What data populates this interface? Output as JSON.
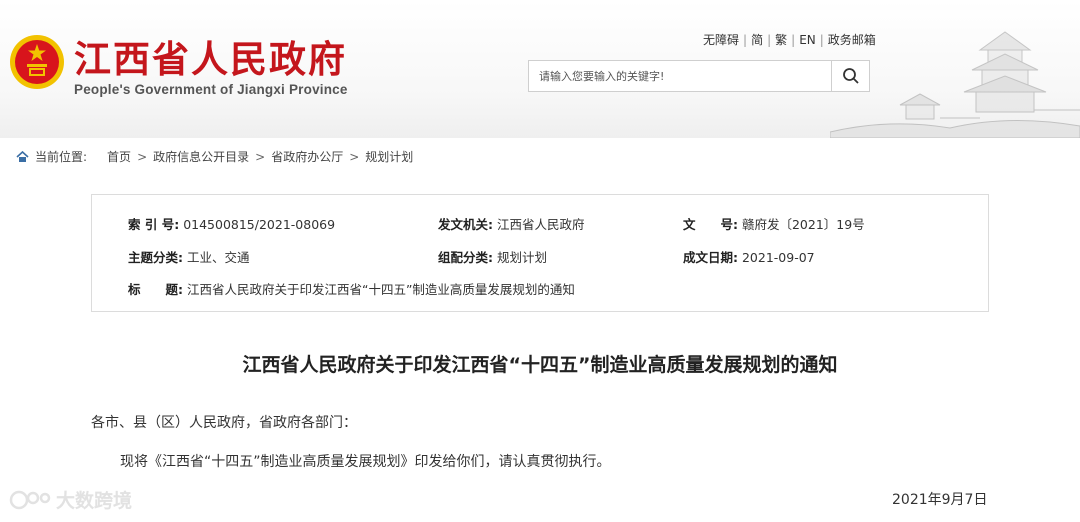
{
  "header": {
    "title": "江西省人民政府",
    "subtitle": "People's Government of Jiangxi Province",
    "links": [
      "无障碍",
      "简",
      "繁",
      "EN",
      "政务邮箱"
    ],
    "search_placeholder": "请输入您要输入的关键字!"
  },
  "breadcrumb": {
    "label": "当前位置:",
    "items": [
      "首页",
      "政府信息公开目录",
      "省政府办公厅",
      "规划计划"
    ]
  },
  "info": {
    "index_label": "索 引 号:",
    "index_value": "014500815/2021-08069",
    "issuer_label": "发文机关:",
    "issuer_value": "江西省人民政府",
    "docno_label": "文　　号:",
    "docno_value": "赣府发〔2021〕19号",
    "topic_label": "主题分类:",
    "topic_value": "工业、交通",
    "category_label": "组配分类:",
    "category_value": "规划计划",
    "date_label": "成文日期:",
    "date_value": "2021-09-07",
    "title_label": "标　　题:",
    "title_value": "江西省人民政府关于印发江西省“十四五”制造业高质量发展规划的通知"
  },
  "article": {
    "title": "江西省人民政府关于印发江西省“十四五”制造业高质量发展规划的通知",
    "salutation": "各市、县（区）人民政府，省政府各部门：",
    "body": "现将《江西省“十四五”制造业高质量发展规划》印发给你们，请认真贯彻执行。",
    "date": "2021年9月7日"
  },
  "watermark": "大数跨境",
  "colors": {
    "brand_red": "#c4161c",
    "emblem_gold": "#f2c200"
  }
}
